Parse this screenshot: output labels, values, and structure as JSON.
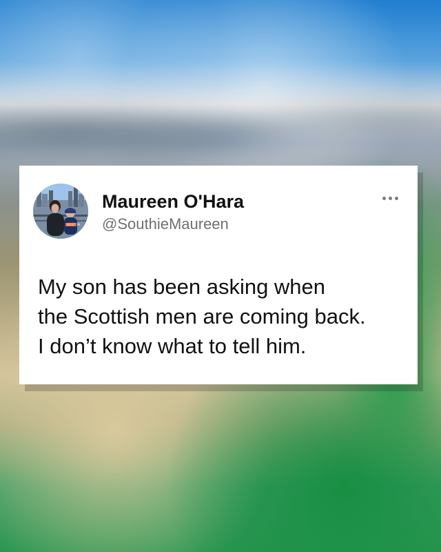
{
  "background": {
    "theme_colors": [
      "#1f7ecf",
      "#d9dde0",
      "#b9ad86",
      "#2b9752"
    ]
  },
  "tweet": {
    "author": {
      "name": "Maureen O'Hara",
      "handle": "@SouthieMaureen",
      "avatar_icon": "profile-photo"
    },
    "menu_icon": "more-options-icon",
    "text_lines": [
      "My son has been asking when",
      "the Scottish men are coming back.",
      "I don’t know what to tell him."
    ]
  }
}
